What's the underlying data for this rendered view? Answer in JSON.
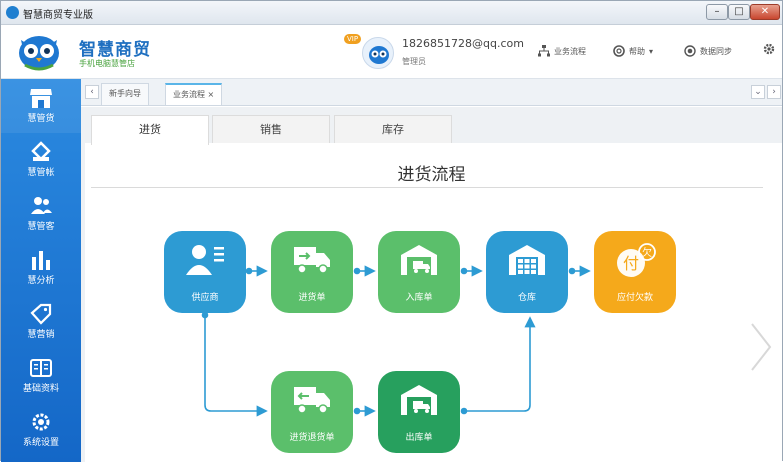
{
  "window": {
    "title": "智慧商贸专业版",
    "minimize_label": "–",
    "maximize_label": "□",
    "close_label": "✕"
  },
  "brand": {
    "name": "智慧商贸",
    "subtitle": "手机电脑慧管店",
    "mascot_icon": "owl-mascot-icon"
  },
  "user": {
    "badge": "VIP",
    "email": "1826851728@qq.com",
    "role": "管理员"
  },
  "header_actions": [
    {
      "label": "业务流程",
      "icon": "flow-icon"
    },
    {
      "label": "帮助",
      "icon": "help-icon"
    },
    {
      "label": "数据同步",
      "icon": "sync-icon"
    },
    {
      "label": "",
      "icon": "gear-icon"
    }
  ],
  "sidebar": {
    "items": [
      {
        "label": "慧管货",
        "icon": "store-icon"
      },
      {
        "label": "慧管帐",
        "icon": "account-icon"
      },
      {
        "label": "慧管客",
        "icon": "customers-icon"
      },
      {
        "label": "慧分析",
        "icon": "bar-chart-icon"
      },
      {
        "label": "慧营销",
        "icon": "tag-icon"
      },
      {
        "label": "基础资料",
        "icon": "book-icon"
      },
      {
        "label": "系统设置",
        "icon": "settings-icon"
      }
    ]
  },
  "open_tabs": [
    {
      "label": "新手向导"
    },
    {
      "label": "业务流程 ×"
    }
  ],
  "sub_tabs": [
    {
      "label": "进货"
    },
    {
      "label": "销售"
    },
    {
      "label": "库存"
    }
  ],
  "flow": {
    "title": "进货流程",
    "nodes": {
      "supplier": "供应商",
      "purchase_order": "进货单",
      "stock_in": "入库单",
      "warehouse": "仓库",
      "payable": "应付欠款",
      "purchase_return": "进货退货单",
      "stock_out": "出库单"
    },
    "payable_icon_char": "付",
    "payable_badge_char": "欠"
  },
  "colors": {
    "primary_blue": "#2d9bd3",
    "green": "#5bbf6b",
    "dark_green": "#27a05e",
    "orange": "#f5a91b",
    "sidebar": "#1f78d1",
    "connector": "#2d9bd3"
  }
}
